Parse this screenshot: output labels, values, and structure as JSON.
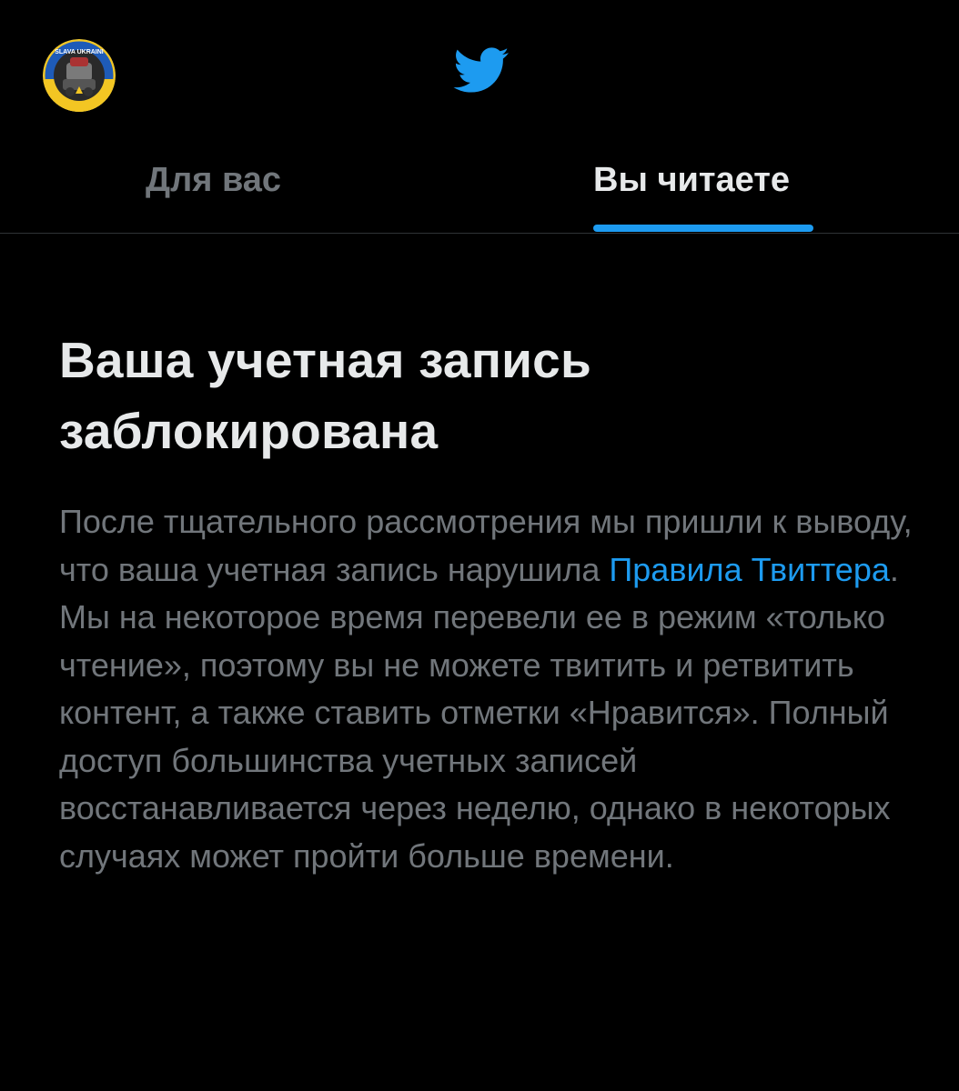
{
  "header": {
    "avatar_text": "SLAVA UKRAINI",
    "logo_icon": "twitter-bird-icon",
    "colors": {
      "background": "#000000",
      "accent": "#1d9bf0"
    }
  },
  "tabs": [
    {
      "label": "Для вас",
      "active": false
    },
    {
      "label": "Вы читаете",
      "active": true
    }
  ],
  "notice": {
    "title_line1": "Ваша учетная запись",
    "title_line2": "заблокирована",
    "body_before_link": "После тщательного рассмотрения мы пришли к выводу, что ваша учетная запись нарушила ",
    "link_text": "Правила Твиттера",
    "body_after_link": ". Мы на некоторое время перевели ее в режим «только чтение», поэтому вы не можете твитить и ретвитить контент, а также ставить отметки «Нравится». Полный доступ большинства учетных записей восстанавливается через неделю, однако в некоторых случаях может пройти больше времени."
  }
}
